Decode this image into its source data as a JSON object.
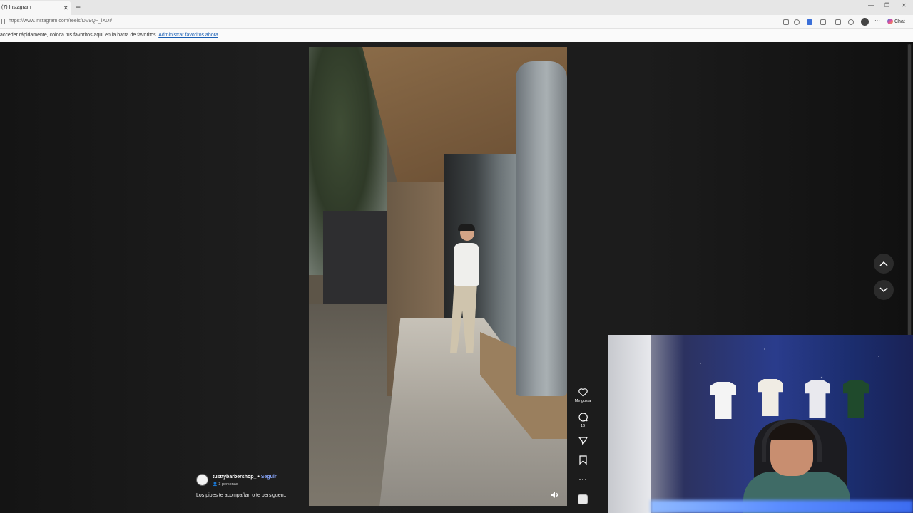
{
  "browser": {
    "tab_title": "(7) Instagram",
    "tab_close": "✕",
    "new_tab": "+",
    "url": "https://www.instagram.com/reels/DV9QF_iXUI/",
    "copilot_label": "Chat",
    "window_controls": [
      "—",
      "❐",
      "✕"
    ]
  },
  "favorites_bar": {
    "text": "acceder rápidamente, coloca tus favoritos aquí en la barra de favoritos.",
    "link": "Administrar favoritos ahora"
  },
  "reel": {
    "username": "tusttybarbershop_",
    "separator": " • ",
    "follow_label": "Seguir",
    "audience": "3 personas",
    "caption": "Los pibes te acompañan o te persiguen...",
    "actions": {
      "like_label": "Me gusta",
      "comments_count": "16"
    }
  },
  "icons": {
    "like": "heart-icon",
    "comment": "comment-icon",
    "share": "send-icon",
    "save": "bookmark-icon",
    "more": "more-icon",
    "mute": "speaker-icon",
    "prev": "chevron-up-icon",
    "next": "chevron-down-icon"
  },
  "colors": {
    "follow_link": "#8aa8ff",
    "favorites_link": "#1a5fb4",
    "background": "#1c1c1c"
  }
}
